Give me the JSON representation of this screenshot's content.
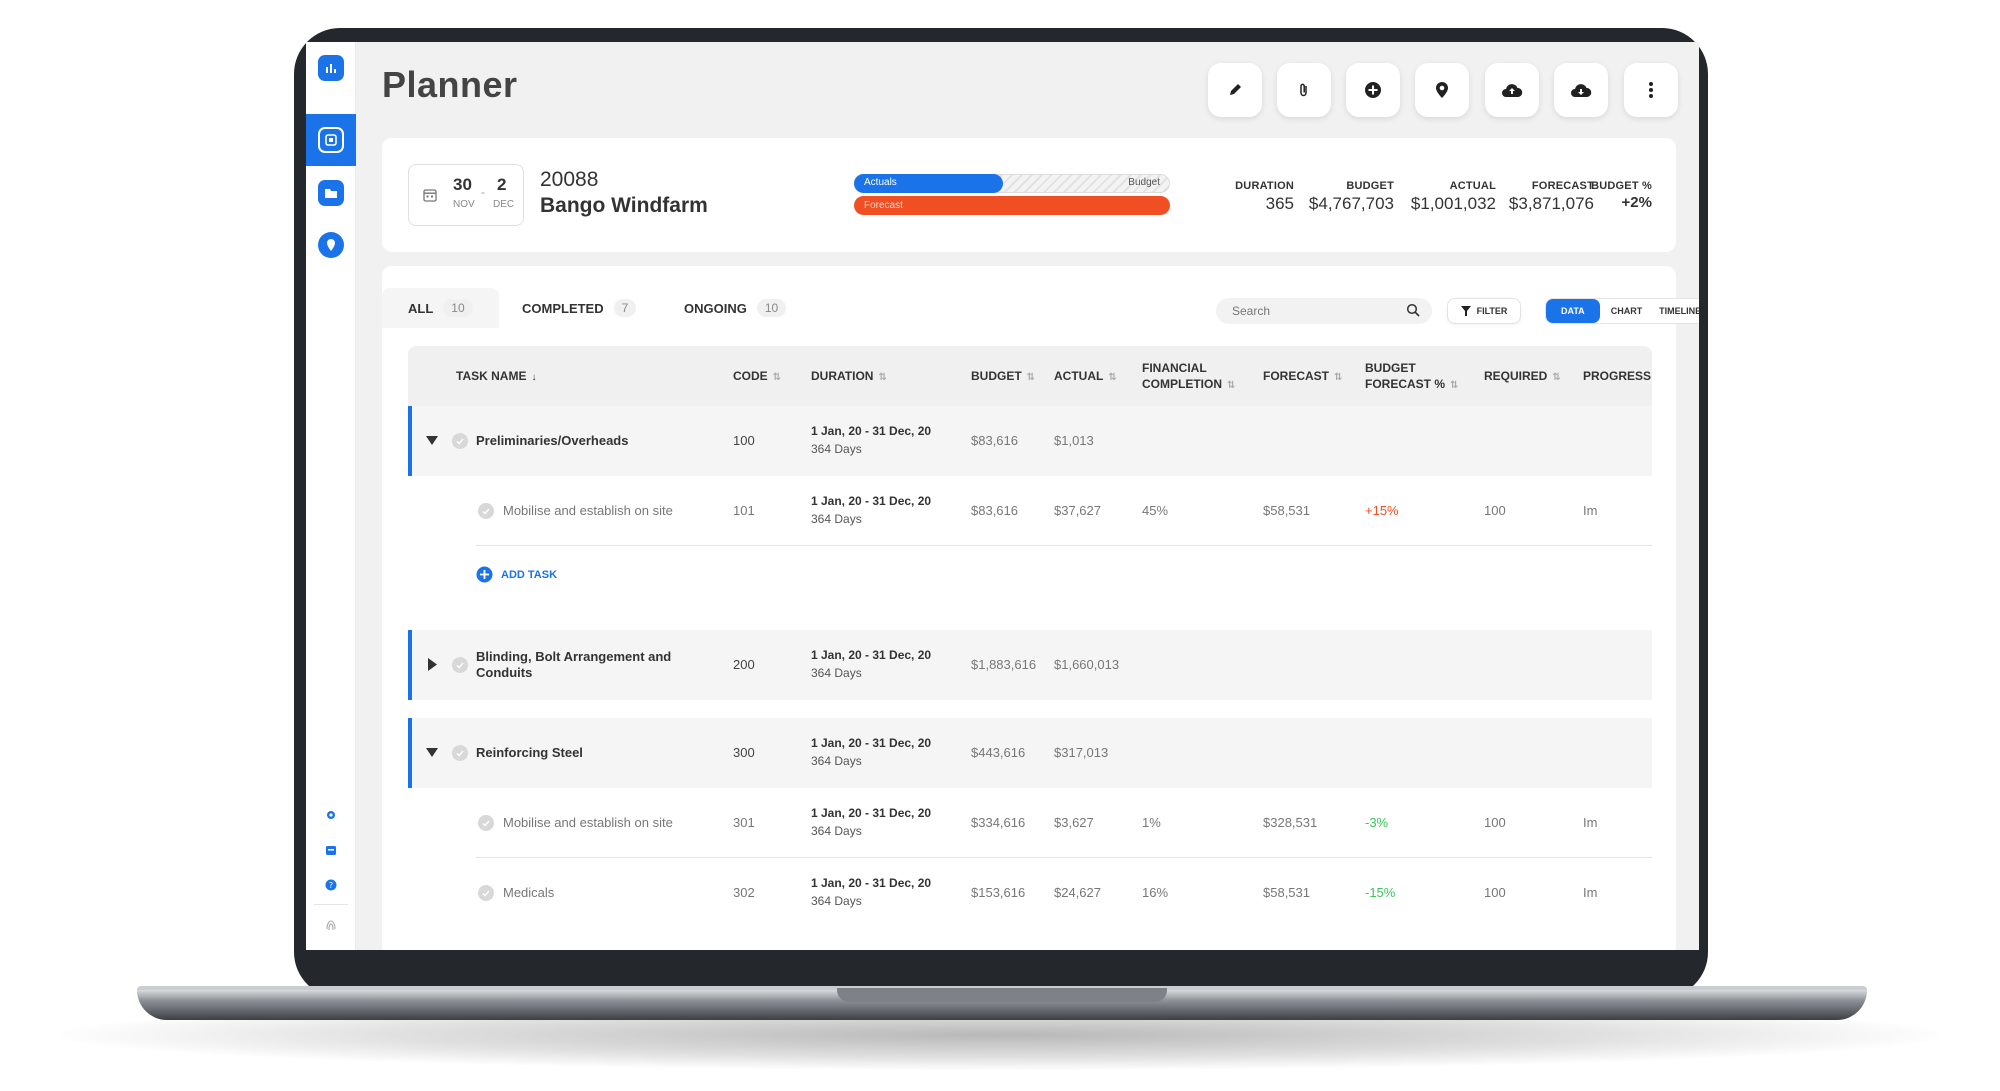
{
  "app": {
    "title": "Planner"
  },
  "project": {
    "start_day": "30",
    "start_month": "NOV",
    "end_day": "2",
    "end_month": "DEC",
    "code": "20088",
    "name": "Bango Windfarm",
    "bar_actual_label": "Actuals",
    "bar_budget_label": "Budget",
    "bar_forecast_label": "Forecast",
    "actual_fraction": 0.47,
    "forecast_fraction": 1.0
  },
  "stats": [
    {
      "label": "DURATION",
      "value": "365"
    },
    {
      "label": "BUDGET",
      "value": "$4,767,703"
    },
    {
      "label": "ACTUAL",
      "value": "$1,001,032"
    },
    {
      "label": "FORECAST",
      "value": "$3,871,076"
    },
    {
      "label": "BUDGET %",
      "value": "+2%"
    }
  ],
  "tabs": [
    {
      "label": "ALL",
      "count": "10"
    },
    {
      "label": "COMPLETED",
      "count": "7"
    },
    {
      "label": "ONGOING",
      "count": "10"
    }
  ],
  "search": {
    "placeholder": "Search"
  },
  "filter_label": "FILTER",
  "view_toggle": [
    "DATA",
    "CHART",
    "TIMELINE"
  ],
  "columns": {
    "task": "TASK NAME",
    "code": "CODE",
    "duration": "DURATION",
    "budget": "BUDGET",
    "actual": "ACTUAL",
    "fin1": "FINANCIAL",
    "fin2": "COMPLETION",
    "forecast": "FORECAST",
    "bf1": "BUDGET",
    "bf2": "FORECAST %",
    "required": "REQUIRED",
    "progress": "PROGRESS"
  },
  "add_task_label": "ADD TASK",
  "rows": [
    {
      "name": "Preliminaries/Overheads",
      "code": "100",
      "dur1": "1 Jan, 20 - 31 Dec, 20",
      "dur2": "364 Days",
      "budget": "$83,616",
      "actual": "$1,013",
      "fin": "",
      "forecast": "",
      "bf": "",
      "required": "",
      "progress": ""
    },
    {
      "name": "Mobilise and establish on site",
      "code": "101",
      "dur1": "1 Jan, 20 - 31 Dec, 20",
      "dur2": "364 Days",
      "budget": "$83,616",
      "actual": "$37,627",
      "fin": "45%",
      "forecast": "$58,531",
      "bf": "+15%",
      "required": "100",
      "progress": "Im"
    },
    {
      "name": "Blinding, Bolt Arrangement and",
      "name2": "Conduits",
      "code": "200",
      "dur1": "1 Jan, 20 - 31 Dec, 20",
      "dur2": "364 Days",
      "budget": "$1,883,616",
      "actual": "$1,660,013",
      "fin": "",
      "forecast": "",
      "bf": "",
      "required": "",
      "progress": ""
    },
    {
      "name": "Reinforcing Steel",
      "code": "300",
      "dur1": "1 Jan, 20 - 31 Dec, 20",
      "dur2": "364 Days",
      "budget": "$443,616",
      "actual": "$317,013",
      "fin": "",
      "forecast": "",
      "bf": "",
      "required": "",
      "progress": ""
    },
    {
      "name": "Mobilise and establish on site",
      "code": "301",
      "dur1": "1 Jan, 20 - 31 Dec, 20",
      "dur2": "364 Days",
      "budget": "$334,616",
      "actual": "$3,627",
      "fin": "1%",
      "forecast": "$328,531",
      "bf": "-3%",
      "required": "100",
      "progress": "Im"
    },
    {
      "name": "Medicals",
      "code": "302",
      "dur1": "1 Jan, 20 - 31 Dec, 20",
      "dur2": "364 Days",
      "budget": "$153,616",
      "actual": "$24,627",
      "fin": "16%",
      "forecast": "$58,531",
      "bf": "-15%",
      "required": "100",
      "progress": "Im"
    }
  ],
  "colors": {
    "accent": "#1a73e8",
    "forecast": "#f04e23",
    "positive": "#f04e23",
    "negative": "#3ec45a"
  },
  "icons": [
    "chart-icon",
    "dashboard-icon",
    "folder-icon",
    "location-icon",
    "settings-icon",
    "archive-icon",
    "help-icon",
    "fingerprint-icon",
    "edit-icon",
    "attach-icon",
    "add-icon",
    "pin-icon",
    "upload-icon",
    "download-icon",
    "more-icon",
    "calendar-icon",
    "search-icon",
    "filter-icon"
  ]
}
